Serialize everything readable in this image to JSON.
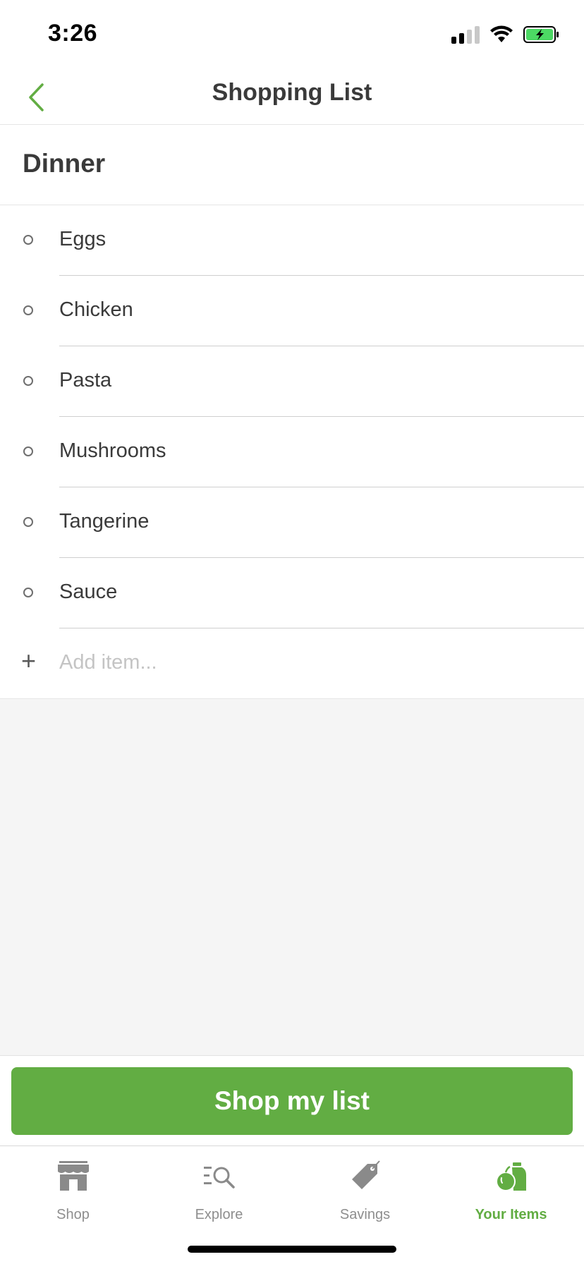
{
  "status_bar": {
    "time": "3:26"
  },
  "header": {
    "title": "Shopping List"
  },
  "list": {
    "title": "Dinner",
    "items": [
      {
        "label": "Eggs"
      },
      {
        "label": "Chicken"
      },
      {
        "label": "Pasta"
      },
      {
        "label": "Mushrooms"
      },
      {
        "label": "Tangerine"
      },
      {
        "label": "Sauce"
      }
    ],
    "add_placeholder": "Add item..."
  },
  "cta": {
    "label": "Shop my list"
  },
  "tabs": [
    {
      "label": "Shop",
      "icon": "storefront-icon",
      "active": false
    },
    {
      "label": "Explore",
      "icon": "explore-search-icon",
      "active": false
    },
    {
      "label": "Savings",
      "icon": "price-tag-icon",
      "active": false
    },
    {
      "label": "Your Items",
      "icon": "produce-icon",
      "active": true
    }
  ],
  "colors": {
    "accent": "#62ad43",
    "text": "#3a3a3a",
    "muted": "#8e8e8e",
    "background_gray": "#f5f5f5"
  }
}
